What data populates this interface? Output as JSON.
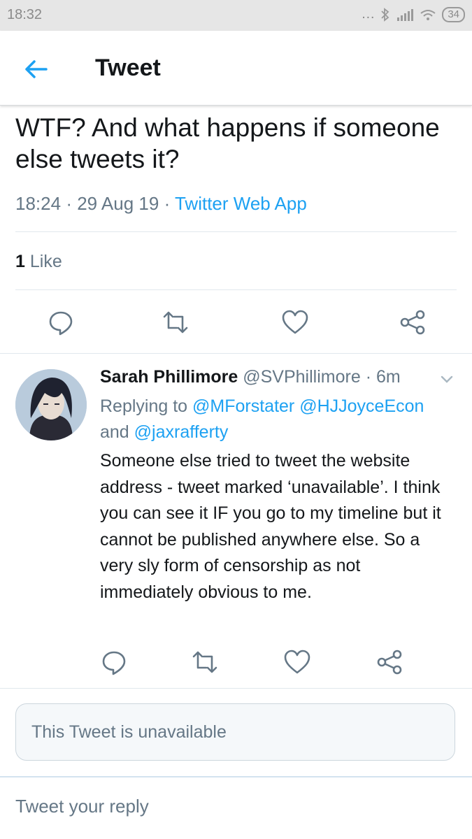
{
  "status_bar": {
    "time": "18:32",
    "battery": "34"
  },
  "app_bar": {
    "title": "Tweet"
  },
  "tweet": {
    "text": "WTF? And what happens if someone else tweets it?",
    "time": "18:24",
    "date": "29 Aug 19",
    "source": "Twitter Web App",
    "likes_count": "1",
    "likes_label": "Like"
  },
  "reply": {
    "name": "Sarah Phillimore",
    "handle": "@SVPhillimore",
    "age": "6m",
    "replying_to_label": "Replying to",
    "replying_to_user1": "@MForstater",
    "replying_to_user2": "@HJJoyceEcon",
    "replying_to_and": "and",
    "replying_to_user3": "@jaxrafferty",
    "text": "Someone else tried to tweet the website address - tweet marked ‘unavailable’. I think you can see it IF you go to my timeline but it cannot be published anywhere else. So a very sly form of censorship as not immediately obvious to me."
  },
  "unavailable_notice": "This Tweet is unavailable",
  "reply_input": {
    "placeholder": "Tweet your reply"
  },
  "colors": {
    "accent": "#1da1f2",
    "secondary_text": "#657786",
    "icon": "#657786"
  },
  "icons": [
    "back-arrow-icon",
    "comment-icon",
    "retweet-icon",
    "like-icon",
    "share-icon",
    "chevron-down-icon"
  ]
}
